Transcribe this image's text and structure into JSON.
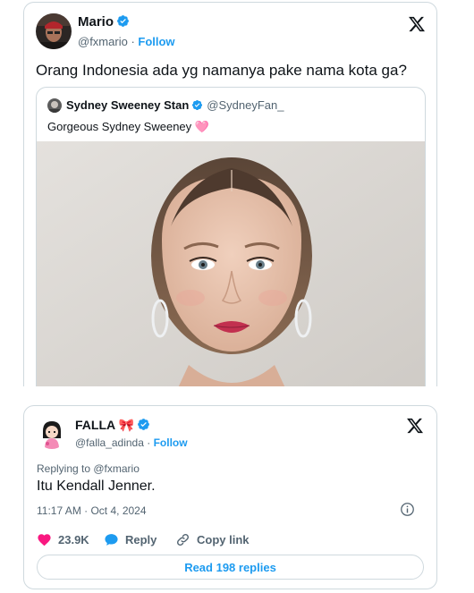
{
  "tweet": {
    "author_name": "Mario",
    "author_handle": "@fxmario",
    "follow_label": "Follow",
    "separator": " · ",
    "text": "Orang Indonesia ada yg namanya pake nama kota ga?",
    "quoted": {
      "author_name": "Sydney Sweeney Stan",
      "author_handle": "@SydneyFan_",
      "text": "Gorgeous Sydney Sweeney 🩷"
    }
  },
  "reply": {
    "author_name": "FALLA",
    "author_emoji": "🎀",
    "author_handle": "@falla_adinda",
    "follow_label": "Follow",
    "separator": " · ",
    "replying_to": "Replying to @fxmario",
    "text": "Itu Kendall Jenner.",
    "timestamp": "11:17 AM · Oct 4, 2024",
    "likes": "23.9K",
    "reply_label": "Reply",
    "copy_link_label": "Copy link",
    "read_replies_label": "Read 198 replies"
  },
  "colors": {
    "accent": "#1d9bf0",
    "like": "#f91880",
    "text": "#0f1419",
    "muted": "#536471",
    "border": "#cfd9de"
  },
  "icons": [
    "verified-badge-icon",
    "x-logo-icon",
    "heart-icon",
    "reply-bubble-icon",
    "link-icon",
    "info-icon"
  ]
}
